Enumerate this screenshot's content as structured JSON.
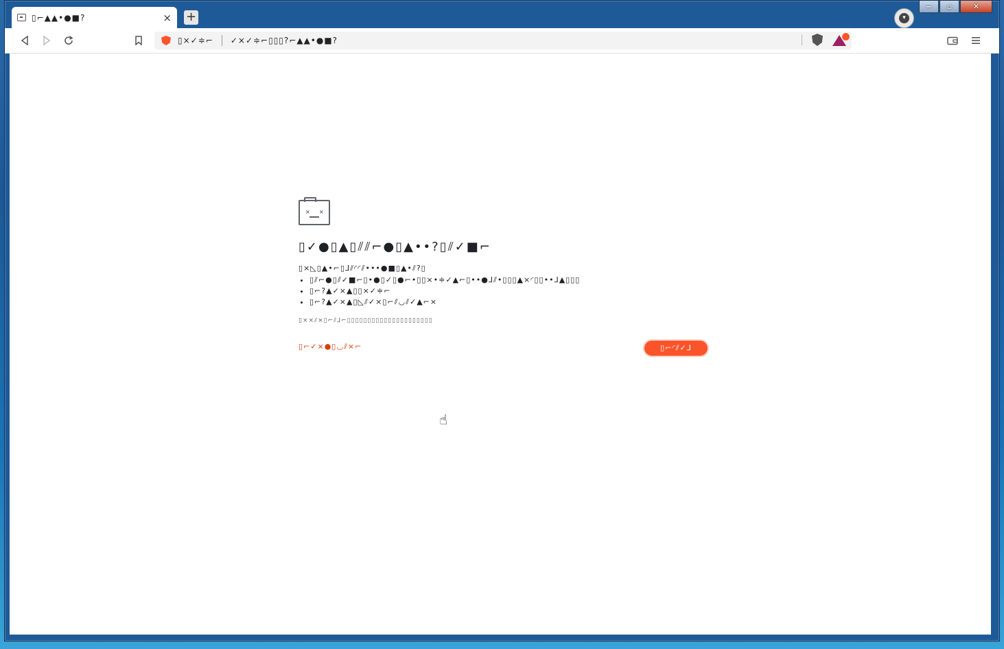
{
  "browser": {
    "tab_title": "▯⌐▲▲•●■?",
    "tab_close": "×",
    "new_tab": "+",
    "url_host": "▯×✓≑⌐",
    "url_path": "✓×✓≑⌐▯▯▯?⌐▲▲•●■?",
    "window_buttons": {
      "minimize": "‒",
      "maximize": "▫",
      "close": "✕"
    }
  },
  "error_page": {
    "heading": "▯✓●▯▲▯⫽⫽⌐●▯▲••?▯⫽✓■⌐",
    "subtext": "▯×◺▯▲•⌐▯⅃⫽◜◜⫽•••●■▯▲•⫽?▯",
    "suggestions": [
      "▯⫽⌐●▯⫽✓■⌐▯•●▯✓▯●⌐•▯▯×•≑✓▲⌐▯••●⅃⫽•▯▯▯▲×◜▯▯••⅃▲▯▯▯",
      "▯⌐?▲✓×▲▯▯×✓≑⌐",
      "▯⌐?▲✓×▲▯◺⫽✓×▯⌐⫽◡⫽✓▲⌐×"
    ],
    "error_code": "▯××⫽×▯⌐⫽⅃⌐▯▯▯▯▯▯▯▯▯▯▯▯▯▯▯▯▯▯▯▯▯",
    "details_link": "▯⌐✓×●▯◡⫽×⌐",
    "reload_button": "▯⌐◜⫽✓⅃"
  },
  "colors": {
    "accent": "#fb542b",
    "link": "#d93f0b",
    "text": "#202124"
  },
  "icons": [
    "back-arrow-icon",
    "forward-arrow-icon",
    "reload-icon",
    "bookmark-icon",
    "brave-shield-icon",
    "brave-rewards-icon",
    "wallet-icon",
    "menu-icon",
    "sad-folder-icon",
    "profile-icon"
  ]
}
